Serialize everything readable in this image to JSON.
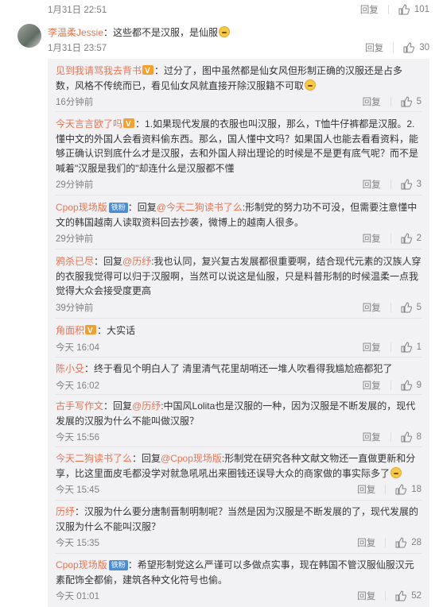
{
  "top": {
    "time": "1月31日 22:51",
    "reply_label": "回复",
    "likes": "101"
  },
  "main": {
    "username": "李温柔Jessie",
    "text": "：这些都不是汉服，是仙服",
    "time": "1月31日 23:57",
    "reply_label": "回复",
    "likes": "30"
  },
  "replies": [
    {
      "user": "见到我请骂我去背书",
      "has_vip": true,
      "badge": "",
      "reply_to": "",
      "text": "：过分了，图中虽然都是仙女风但形制正确的汉服还是占多数，风格不传统而已，看见仙女风就直接开除汉服籍不可取",
      "emoji_end": true,
      "time": "16分钟前",
      "likes": "5"
    },
    {
      "user": "今天言言欧了吗",
      "has_vip": true,
      "badge": "",
      "reply_to": "",
      "text": "：1.如果现代发展的衣服也叫汉服，那么，T恤牛仔裤都是汉服。2.懂中文的外国人会看资料偷东西。那么，国人懂中文吗？如果国人也能去看看资料，能够正确认识到底什么才是汉服，去和外国人辩出理论的时候是不是更有底气呢？而不是喊着\"汉服是我们的\"却连什么是汉服都不懂",
      "emoji_end": false,
      "time": "29分钟前",
      "likes": "3"
    },
    {
      "user": "Cpop现场版",
      "has_vip": false,
      "badge": "铁粉",
      "reply_prefix": "：回复",
      "reply_to": "@今天二狗读书了么",
      "text": ":形制党的努力功不可没，但需要注意懂中文的韩国越南人读取资料回去抄袭，微博上的越南人很多。",
      "emoji_end": false,
      "time": "29分钟前",
      "likes": "2"
    },
    {
      "user": "鸦杀已尽",
      "has_vip": false,
      "badge": "",
      "reply_prefix": "：回复",
      "reply_to": "@历纾",
      "text": ":我也认同，复兴复古发展都很重要啊，结合现代元素的汉族人穿的衣服我觉得可以归于汉服啊，当然可以说这是仙服，只是料普形制的时候温柔一点我觉得大众会接受度更高",
      "emoji_end": false,
      "time": "39分钟前",
      "likes": "5"
    },
    {
      "user": "角面积",
      "has_vip": true,
      "badge": "",
      "reply_to": "",
      "text": "：大实话",
      "emoji_end": false,
      "time": "今天 16:04",
      "likes": "1"
    },
    {
      "user": "陈小殳",
      "has_vip": false,
      "badge": "",
      "reply_to": "",
      "text": "：终于看见个明白人了 清里清气花里胡哨还一堆人吹看得我尴尬癌都犯了",
      "emoji_end": false,
      "time": "今天 16:02",
      "likes": "9"
    },
    {
      "user": "古手写作文",
      "has_vip": false,
      "badge": "",
      "reply_prefix": "：回复",
      "reply_to": "@历纾",
      "text": ":中国风Lolita也是汉服的一种，因为汉服是不断发展的，现代发展的汉服为什么不能叫做汉服？",
      "emoji_end": false,
      "time": "今天 15:56",
      "likes": "8"
    },
    {
      "user": "今天二狗读书了么",
      "has_vip": false,
      "badge": "",
      "reply_prefix": "：回复",
      "reply_to": "@Cpop现场版",
      "text": ":形制党在研究各种文献文物还一直做更新和分享，比这里面皮毛都没学对就急吼吼出来圈钱还误导大众的商家做的事实际多了",
      "emoji_end": true,
      "time": "今天 15:45",
      "likes": "18"
    },
    {
      "user": "历纾",
      "has_vip": false,
      "badge": "",
      "reply_to": "",
      "text": "：汉服为什么要分唐制晋制明制呢？当然是因为汉服是不断发展的了，现代发展的汉服为什么不能叫汉服？",
      "emoji_end": false,
      "time": "今天 15:35",
      "likes": "28"
    },
    {
      "user": "Cpop现场版",
      "has_vip": false,
      "badge": "铁粉",
      "reply_to": "",
      "text": "：希望形制党这么严谨可以多做点实事，现在韩国不管汉服仙服汉元素配饰全都偷，建筑各种文化符号也偷。",
      "emoji_end": false,
      "time": "今天 01:01",
      "likes": "52"
    }
  ]
}
